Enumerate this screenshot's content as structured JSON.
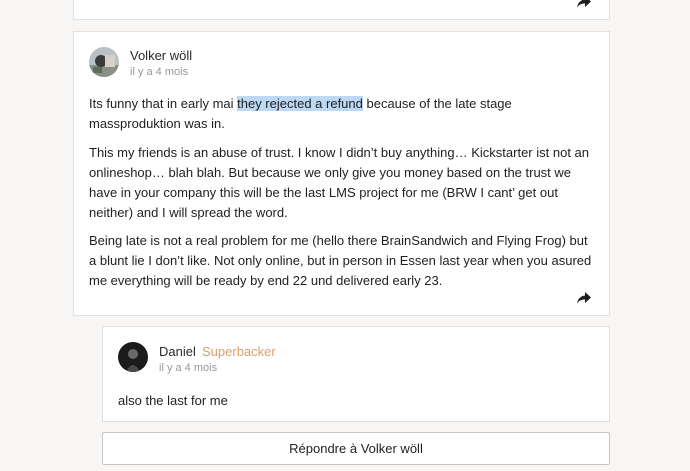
{
  "previous_post": {
    "share_icon": "share-arrow-icon"
  },
  "post": {
    "author": "Volker wöll",
    "time": "il y a 4 mois",
    "paragraphs": {
      "p1_before": "Its funny that in early mai ",
      "p1_highlight": "they rejected a refund",
      "p1_after": " because of the late stage massproduktion was in.",
      "p2": "This my friends is an abuse of trust. I know I didn’t buy anything… Kickstarter ist not an onlineshop… blah blah. But because we only give you money based on the trust we have in your company this will be the last LMS project for me (BRW I cant’ get out neither) and I will spread the word.",
      "p3": "Being late is not a real problem for me (hello there BrainSandwich and Flying Frog) but a blunt lie I don’t like. Not only online, but in person in Essen last year when you asured me everything will be ready by end 22 und delivered early 23."
    },
    "share_icon": "share-arrow-icon"
  },
  "reply": {
    "author": "Daniel",
    "badge": "Superbacker",
    "time": "il y a 4 mois",
    "text": "also the last for me"
  },
  "reply_button": {
    "label": "Répondre à Volker wöll"
  },
  "colors": {
    "highlight": "#bcd8f2",
    "badge": "#d9a06a",
    "border": "#e3e1df"
  }
}
